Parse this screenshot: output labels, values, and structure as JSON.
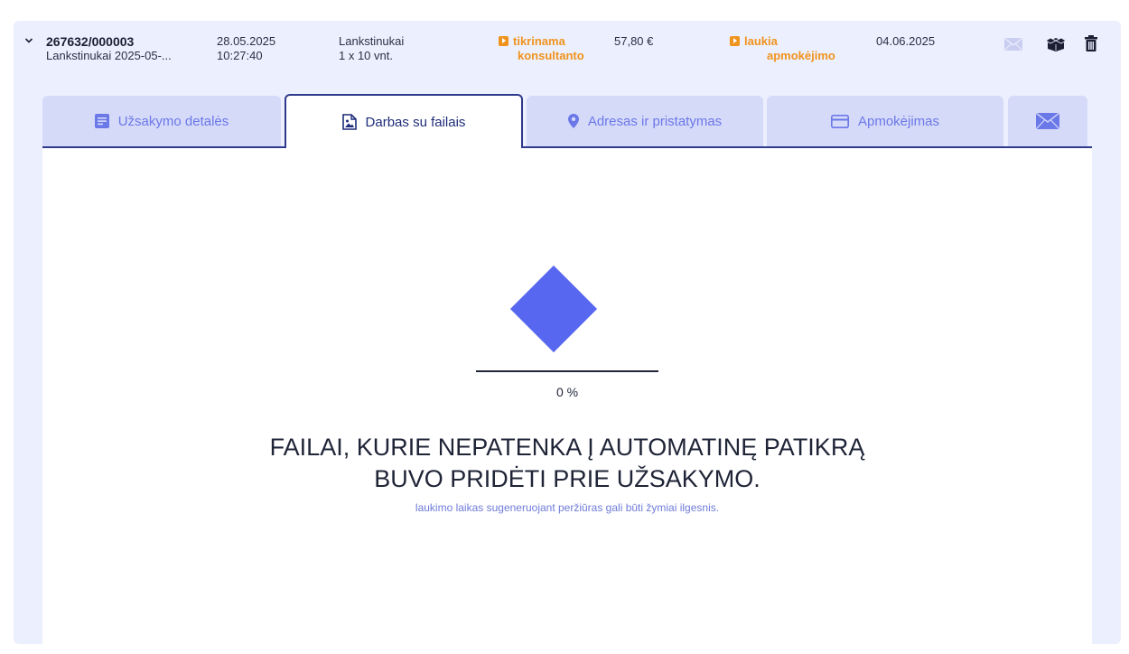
{
  "order": {
    "id": "267632/000003",
    "subtitle": "Lankstinukai 2025-05-...",
    "date": "28.05.2025",
    "time": "10:27:40",
    "product": "Lankstinukai",
    "quantity": "1 x 10 vnt.",
    "status_line1": "tikrinama",
    "status_line2": "konsultanto",
    "price": "57,80 €",
    "payment_line1": "laukia",
    "payment_line2": "apmokėjimo",
    "due_date": "04.06.2025"
  },
  "icons": {
    "mail": "envelope-icon",
    "box": "box-icon",
    "delete": "trash-icon"
  },
  "tabs": [
    {
      "label": "Užsakymo detalės",
      "icon": "document-icon",
      "active": false
    },
    {
      "label": "Darbas su failais",
      "icon": "image-file-icon",
      "active": true
    },
    {
      "label": "Adresas ir pristatymas",
      "icon": "location-pin-icon",
      "active": false
    },
    {
      "label": "Apmokėjimas",
      "icon": "credit-card-icon",
      "active": false
    },
    {
      "label": "",
      "icon": "envelope-icon",
      "active": false
    }
  ],
  "progress": {
    "percent_label": "0 %",
    "value": 0
  },
  "message": {
    "line1": "FAILAI, KURIE NEPATENKA Į AUTOMATINĘ PATIKRĄ",
    "line2": "BUVO PRIDĖTI PRIE UŽSAKYMO.",
    "note": "laukimo laikas sugeneruojant peržiūras gali būti žymiai ilgesnis."
  },
  "colors": {
    "accent": "#5867ef",
    "status_orange": "#f0931d",
    "tab_inactive": "#d6daf9",
    "tab_border": "#2e3a8c",
    "background": "#eceffd"
  }
}
